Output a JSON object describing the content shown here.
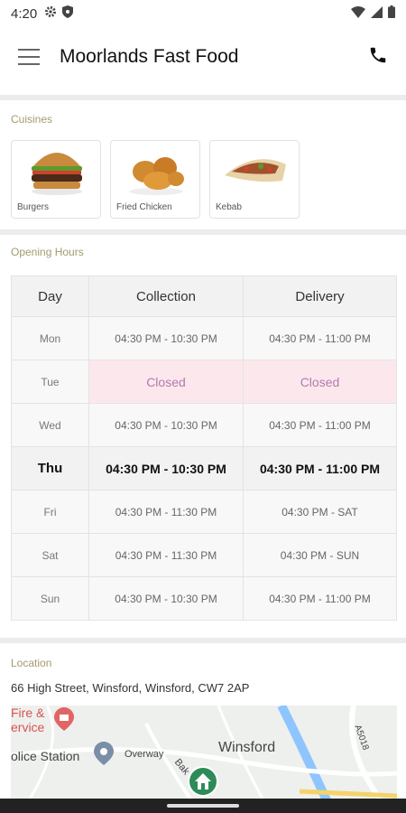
{
  "status_bar": {
    "time": "4:20"
  },
  "app_bar": {
    "title": "Moorlands Fast Food"
  },
  "cuisines": {
    "label": "Cuisines",
    "items": [
      {
        "name": "Burgers"
      },
      {
        "name": "Fried Chicken"
      },
      {
        "name": "Kebab"
      }
    ]
  },
  "opening_hours": {
    "label": "Opening Hours",
    "headers": {
      "day": "Day",
      "collection": "Collection",
      "delivery": "Delivery"
    },
    "rows": [
      {
        "day": "Mon",
        "collection": "04:30 PM - 10:30 PM",
        "delivery": "04:30 PM - 11:00 PM"
      },
      {
        "day": "Tue",
        "collection": "Closed",
        "delivery": "Closed"
      },
      {
        "day": "Wed",
        "collection": "04:30 PM - 10:30 PM",
        "delivery": "04:30 PM - 11:00 PM"
      },
      {
        "day": "Thu",
        "collection": "04:30 PM - 10:30 PM",
        "delivery": "04:30 PM - 11:00 PM"
      },
      {
        "day": "Fri",
        "collection": "04:30 PM - 11:30 PM",
        "delivery": "04:30 PM - SAT"
      },
      {
        "day": "Sat",
        "collection": "04:30 PM - 11:30 PM",
        "delivery": "04:30 PM - SUN"
      },
      {
        "day": "Sun",
        "collection": "04:30 PM - 10:30 PM",
        "delivery": "04:30 PM - 11:00 PM"
      }
    ]
  },
  "location": {
    "label": "Location",
    "address": "66 High Street, Winsford, Winsford, CW7 2AP",
    "map_labels": {
      "fire": "Fire &",
      "service": "ervice",
      "police": "olice Station",
      "overway": "Overway",
      "town": "Winsford",
      "road": "A5018",
      "bak": "Bak"
    }
  },
  "icons": {
    "menu": "hamburger-menu-icon",
    "phone": "phone-icon",
    "settings": "gear-icon",
    "shield": "shield-icon",
    "wifi": "wifi-icon",
    "signal": "signal-icon",
    "battery": "battery-icon",
    "home_marker": "home-marker-icon"
  },
  "colors": {
    "section_label": "#a59a6c",
    "closed_bg": "#fce8ec",
    "closed_text": "#b27ab0",
    "map_marker": "#2e8b57"
  }
}
